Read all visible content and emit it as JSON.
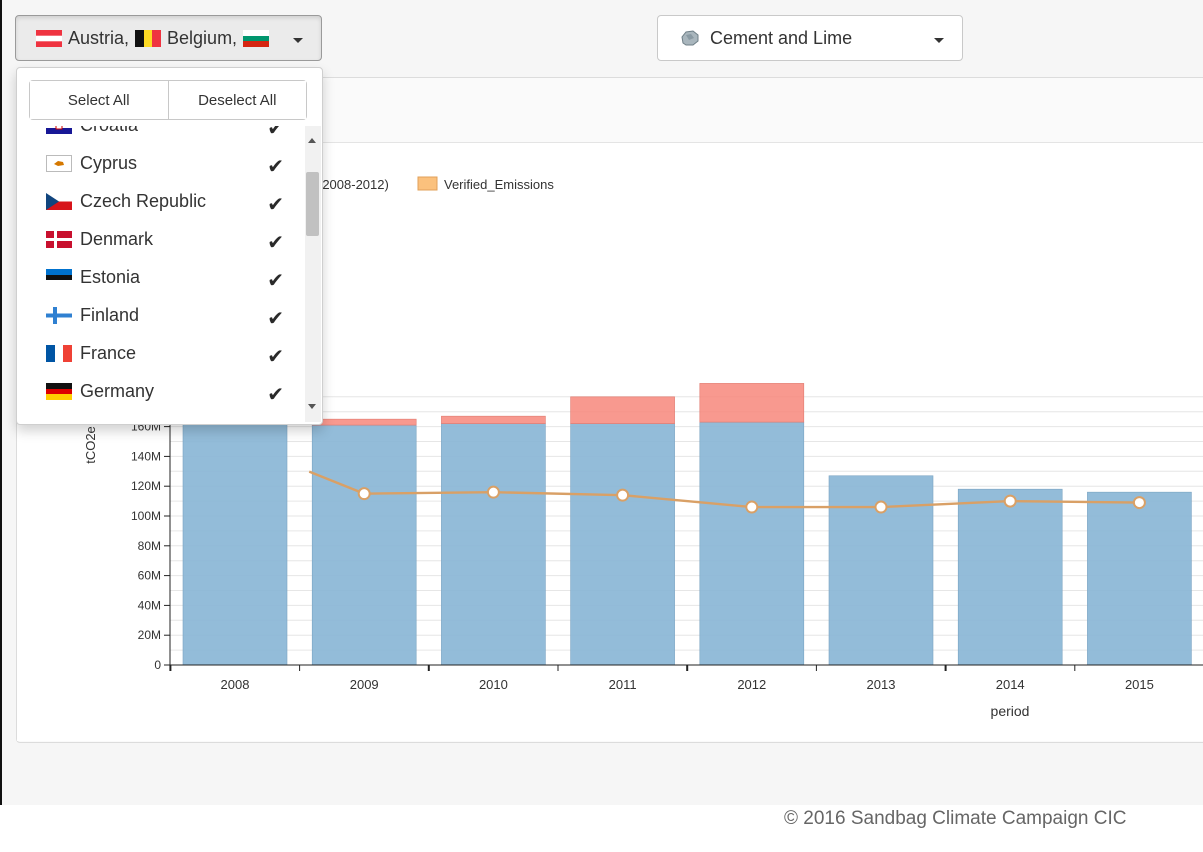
{
  "country_selector": {
    "label": "Austria, Belgium,",
    "label_parts": [
      "Austria,",
      "Belgium,"
    ],
    "flags": [
      "austria-flag",
      "belgium-flag",
      "bulgaria-flag"
    ]
  },
  "sector_selector": {
    "label": "Cement and Lime",
    "icon": "rock-icon"
  },
  "dropdown": {
    "select_all": "Select All",
    "deselect_all": "Deselect All",
    "items": [
      {
        "label": "Croatia",
        "flag": "croatia-flag",
        "checked": true
      },
      {
        "label": "Cyprus",
        "flag": "cyprus-flag",
        "checked": true
      },
      {
        "label": "Czech Republic",
        "flag": "czech-flag",
        "checked": true
      },
      {
        "label": "Denmark",
        "flag": "denmark-flag",
        "checked": true
      },
      {
        "label": "Estonia",
        "flag": "estonia-flag",
        "checked": true
      },
      {
        "label": "Finland",
        "flag": "finland-flag",
        "checked": true
      },
      {
        "label": "France",
        "flag": "france-flag",
        "checked": true
      },
      {
        "label": "Germany",
        "flag": "germany-flag",
        "checked": true
      }
    ],
    "check_glyph": "✔"
  },
  "chart_data": {
    "type": "bar",
    "categories": [
      "2008",
      "2009",
      "2010",
      "2011",
      "2012",
      "2013",
      "2014",
      "2015"
    ],
    "series": [
      {
        "name": "",
        "type": "bar",
        "color": "#8ab6d6",
        "values": [
          170000000,
          161000000,
          162000000,
          162000000,
          163000000,
          127000000,
          118000000,
          116000000
        ]
      },
      {
        "name": "",
        "type": "bar-stacked",
        "color": "#f7877b",
        "values": [
          0,
          4000000,
          5000000,
          18000000,
          26000000,
          0,
          0,
          0
        ]
      },
      {
        "name": "",
        "type": "line",
        "color": "#d9a066",
        "values": [
          null,
          115000000,
          116000000,
          114000000,
          106000000,
          106000000,
          110000000,
          109000000
        ]
      }
    ],
    "legend": {
      "partial_text": "(2008-2012)",
      "entries": [
        "Verified_Emissions"
      ],
      "colors": [
        "#fbc17d"
      ],
      "position": "top-left"
    },
    "xlabel": "period",
    "ylabel": "tCO2e",
    "yticks": [
      "0",
      "20M",
      "40M",
      "60M",
      "80M",
      "100M",
      "120M",
      "140M",
      "160M"
    ],
    "ylim": [
      0,
      180000000
    ],
    "grid": true
  },
  "footer": {
    "copyright": "© 2016 Sandbag Climate Campaign CIC"
  },
  "colors": {
    "bar": "#8ab6d6",
    "surplus": "#f7877b",
    "line": "#d9a066",
    "legend_swatch": "#fbc17d"
  }
}
